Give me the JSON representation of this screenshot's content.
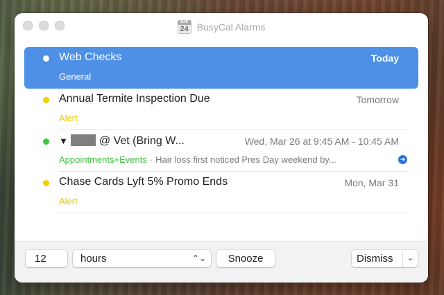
{
  "window": {
    "title": "BusyCal Alarms",
    "icon": {
      "name": "calendar-icon",
      "month": "MAR",
      "day": "24"
    }
  },
  "alarms": [
    {
      "title": "Web Checks",
      "when": "Today",
      "calendar": "General",
      "calendar_color": "#ffffff",
      "dot_color": "#ffffff",
      "selected": true
    },
    {
      "title": "Annual Termite Inspection Due",
      "when": "Tomorrow",
      "calendar": "Alert",
      "calendar_color": "#e6c800",
      "dot_color": "#f2cf00",
      "selected": false
    },
    {
      "title_prefix": "▼",
      "title": "@ Vet (Bring W...",
      "when": "Wed, Mar 26 at 9:45 AM - 10:45 AM",
      "calendar": "Appointments+Events",
      "calendar_color": "#3cbf3c",
      "separator": "·",
      "notes": "Hair loss first noticed Pres Day weekend by...",
      "dot_color": "#3cc93c",
      "has_redacted_name": true,
      "action_icon": "arrow-right-circle-icon",
      "selected": false
    },
    {
      "title": "Chase Cards Lyft 5% Promo Ends",
      "when": "Mon, Mar 31",
      "calendar": "Alert",
      "calendar_color": "#e6c800",
      "dot_color": "#f2cf00",
      "selected": false
    }
  ],
  "footer": {
    "snooze_amount": "12",
    "snooze_unit": "hours",
    "snooze_label": "Snooze",
    "dismiss_label": "Dismiss"
  },
  "colors": {
    "selection": "#4e90e6",
    "alert_yellow": "#e6c800",
    "appointments_green": "#3cbf3c"
  }
}
